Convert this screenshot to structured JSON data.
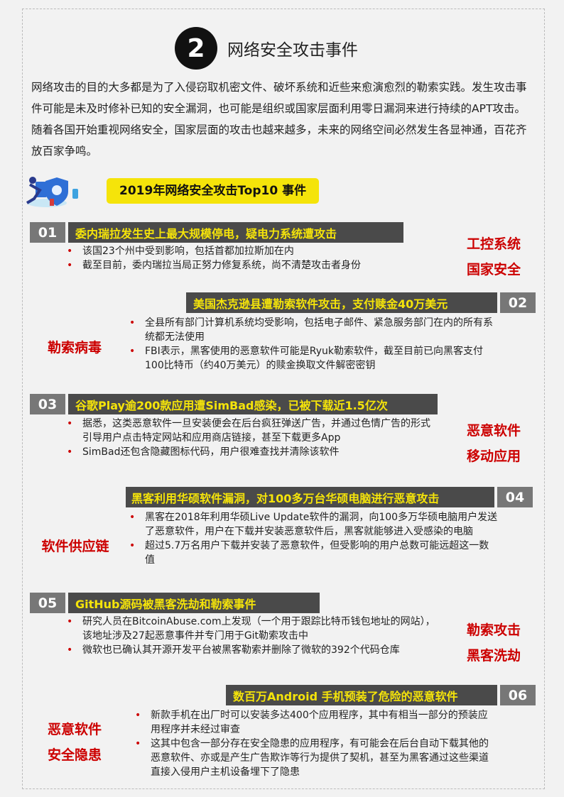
{
  "section": {
    "number": "2",
    "title": "网络安全攻击事件"
  },
  "intro": "网络攻击的目的大多都是为了入侵窃取机密文件、破坏系统和近些来愈演愈烈的勒索实践。发生攻击事件可能是未及时修补已知的安全漏洞，也可能是组织或国家层面利用零日漏洞来进行持续的APT攻击。随着各国开始重视网络安全，国家层面的攻击也越来越多，未来的网络空间必然发生各显神通，百花齐放百家争鸣。",
  "top10_label": "2019年网络安全攻击Top10 事件",
  "events": [
    {
      "num": "01",
      "title": "委内瑞拉发生史上最大规模停电，疑电力系统遭攻击",
      "bullets": [
        "该国23个州中受到影响，包括首都加拉斯加在内",
        "截至目前，委内瑞拉当局正努力修复系统，尚不清楚攻击者身份"
      ],
      "tags": [
        "工控系统",
        "国家安全"
      ]
    },
    {
      "num": "02",
      "title": "美国杰克逊县遭勒索软件攻击，支付赎金40万美元",
      "bullets": [
        "全县所有部门计算机系统均受影响，包括电子邮件、紧急服务部门在内的所有系统都无法使用",
        "FBI表示，黑客使用的恶意软件可能是Ryuk勒索软件，截至目前已向黑客支付100比特币（约40万美元）的赎金换取文件解密密钥"
      ],
      "tags": [
        "勒索病毒"
      ]
    },
    {
      "num": "03",
      "title": "谷歌Play逾200款应用遭SimBad感染，已被下载近1.5亿次",
      "bullets": [
        "据悉，这类恶意软件一旦安装便会在后台疯狂弹送广告，并通过色情广告的形式引导用户点击特定网站和应用商店链接，甚至下载更多App",
        "SimBad还包含隐藏图标代码，用户很难查找并清除该软件"
      ],
      "tags": [
        "恶意软件",
        "移动应用"
      ]
    },
    {
      "num": "04",
      "title": "黑客利用华硕软件漏洞，对100多万台华硕电脑进行恶意攻击",
      "bullets": [
        "黑客在2018年利用华硕Live Update软件的漏洞，向100多万华硕电脑用户发送了恶意软件，用户在下载并安装恶意软件后，黑客就能够进入受感染的电脑",
        "超过5.7万名用户下载并安装了恶意软件，但受影响的用户总数可能远超这一数值"
      ],
      "tags": [
        "软件供应链"
      ]
    },
    {
      "num": "05",
      "title": "GitHub源码被黑客洗劫和勒索事件",
      "bullets": [
        "研究人员在BitcoinAbuse.com上发现（一个用于跟踪比特币钱包地址的网站），该地址涉及27起恶意事件并专门用于Git勒索攻击中",
        "微软也已确认其开源开发平台被黑客勒索并删除了微软的392个代码仓库"
      ],
      "tags": [
        "勒索攻击",
        "黑客洗劫"
      ]
    },
    {
      "num": "06",
      "title": "数百万Android 手机预装了危险的恶意软件",
      "bullets": [
        "新款手机在出厂时可以安装多达400个应用程序，其中有相当一部分的预装应用程序并未经过审查",
        "这其中包含一部分存在安全隐患的应用程序，有可能会在后台自动下载其他的恶意软件、亦或是产生广告欺诈等行为提供了契机，甚至为黑客通过这些渠道直接入侵用户主机设备埋下了隐患"
      ],
      "tags": [
        "恶意软件",
        "安全隐患"
      ]
    }
  ],
  "colors": {
    "accent_yellow": "#f5e40a",
    "tag_red": "#cc0000",
    "bar_dark": "#4a4a4a",
    "num_gray": "#777777"
  }
}
